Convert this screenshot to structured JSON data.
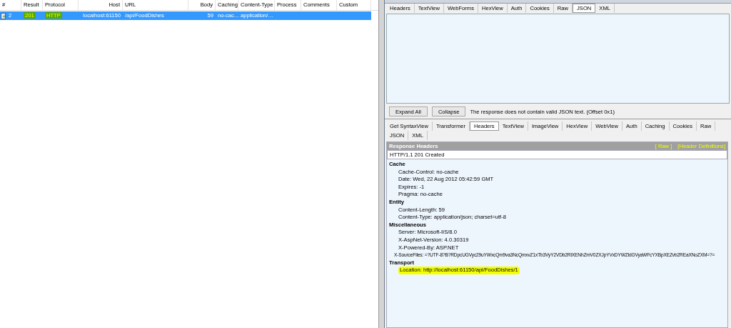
{
  "sessions": {
    "columns": [
      "#",
      "Result",
      "Protocol",
      "Host",
      "URL",
      "Body",
      "Caching",
      "Content-Type",
      "Process",
      "Comments",
      "Custom"
    ],
    "rows": [
      {
        "selected": true,
        "cells": [
          {
            "text": "2",
            "highlighted": false
          },
          {
            "text": "201",
            "highlighted": true
          },
          {
            "text": "HTTP",
            "highlighted": true
          },
          {
            "text": "localhost:61150",
            "highlighted": false
          },
          {
            "text": "/api/FoodDishes",
            "highlighted": false
          },
          {
            "text": "59",
            "highlighted": false
          },
          {
            "text": "no-cac…",
            "highlighted": false
          },
          {
            "text": "application/…",
            "highlighted": false
          }
        ]
      }
    ]
  },
  "request_tabs": [
    {
      "label": "Headers",
      "selected": false
    },
    {
      "label": "TextView",
      "selected": false
    },
    {
      "label": "WebForms",
      "selected": false
    },
    {
      "label": "HexView",
      "selected": false
    },
    {
      "label": "Auth",
      "selected": false
    },
    {
      "label": "Cookies",
      "selected": false
    },
    {
      "label": "Raw",
      "selected": false
    },
    {
      "label": "JSON",
      "selected": true
    },
    {
      "label": "XML",
      "selected": false
    }
  ],
  "json_toolbar": {
    "buttons": [
      "Expand All",
      "Collapse"
    ],
    "message": "The response does not contain valid JSON text. (Offset 0x1)"
  },
  "response_tabs": [
    [
      {
        "label": "Get SyntaxView",
        "selected": false
      },
      {
        "label": "Transformer",
        "selected": false
      },
      {
        "label": "Headers",
        "selected": true
      },
      {
        "label": "TextView",
        "selected": false
      },
      {
        "label": "ImageView",
        "selected": false
      },
      {
        "label": "HexView",
        "selected": false
      },
      {
        "label": "WebView",
        "selected": false
      },
      {
        "label": "Auth",
        "selected": false
      },
      {
        "label": "Caching",
        "selected": false
      },
      {
        "label": "Cookies",
        "selected": false
      },
      {
        "label": "Raw",
        "selected": false
      }
    ],
    [
      {
        "label": "JSON",
        "selected": false
      },
      {
        "label": "XML",
        "selected": false
      }
    ]
  ],
  "response_headers": {
    "title": "Response Headers",
    "links": [
      "[ Raw ]",
      "[Header Definitions]"
    ],
    "status_line": "HTTP/1.1 201 Created",
    "groups": [
      {
        "name": "Cache",
        "headers": [
          {
            "text": "Cache-Control: no-cache",
            "highlighted": false
          },
          {
            "text": "Date: Wed, 22 Aug 2012 05:42:59 GMT",
            "highlighted": false
          },
          {
            "text": "Expires: -1",
            "highlighted": false
          },
          {
            "text": "Pragma: no-cache",
            "highlighted": false
          }
        ]
      },
      {
        "name": "Entity",
        "headers": [
          {
            "text": "Content-Length: 59",
            "highlighted": false
          },
          {
            "text": "Content-Type: application/json; charset=utf-8",
            "highlighted": false
          }
        ]
      },
      {
        "name": "Miscellaneous",
        "headers": [
          {
            "text": "Server: Microsoft-IIS/8.0",
            "highlighted": false
          },
          {
            "text": "X-AspNet-Version: 4.0.30319",
            "highlighted": false
          },
          {
            "text": "X-Powered-By: ASP.NET",
            "highlighted": false
          },
          {
            "text": "X-SourceFiles: =?UTF-8?B?RDpcUGVyc29uYWxcQm9va3NcQmxvZ1xTb3VyY2VDb2RlXENhZmV0ZXJpYVxDYWZldGVyaWFcYXBpXEZvb2REaXNoZXM=?=",
            "highlighted": false
          }
        ]
      },
      {
        "name": "Transport",
        "headers": [
          {
            "text": "Location: http://localhost:61150/api/FoodDishes/1",
            "highlighted": true
          }
        ]
      }
    ]
  }
}
